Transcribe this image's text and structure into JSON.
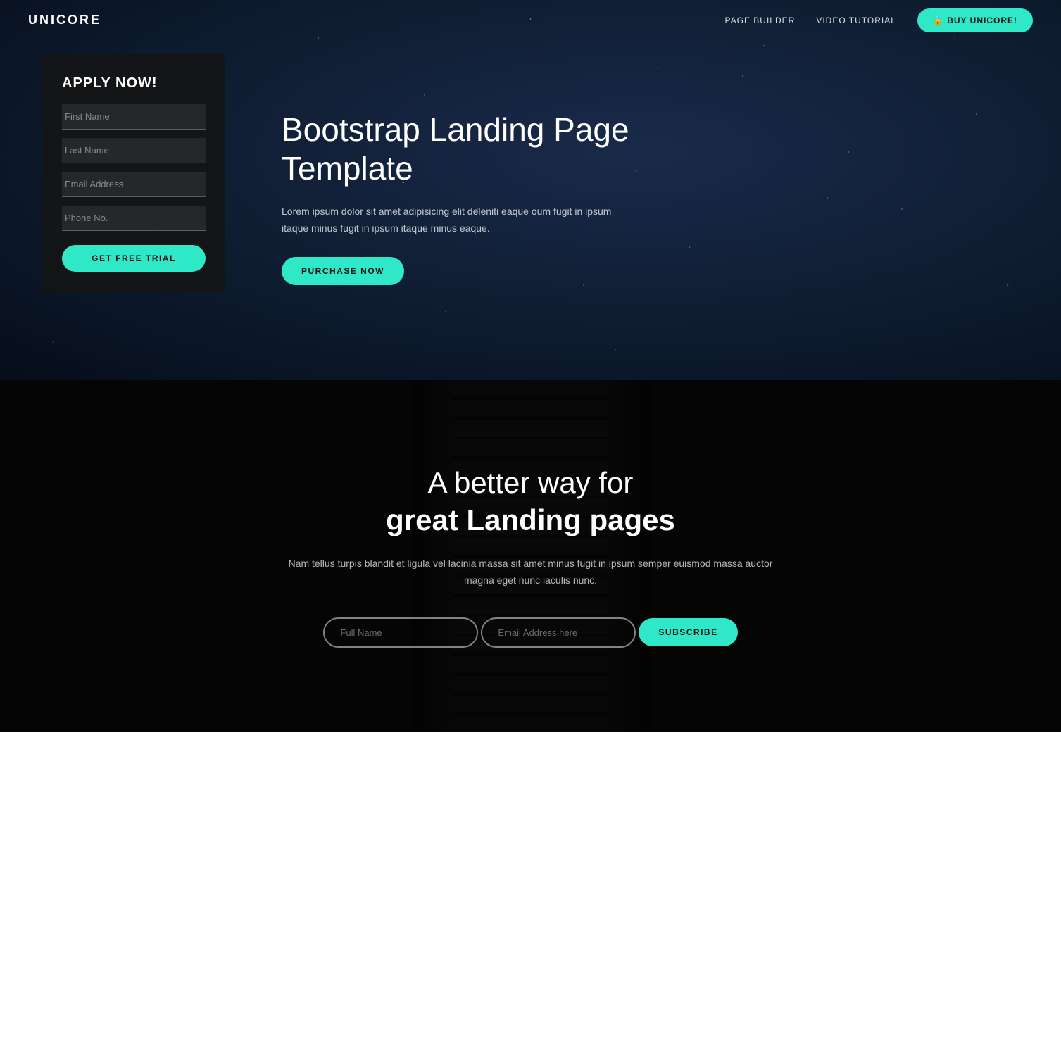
{
  "nav": {
    "logo": "UNICORE",
    "links": [
      {
        "label": "PAGE BUILDER",
        "id": "page-builder"
      },
      {
        "label": "VIDEO TUTORIAL",
        "id": "video-tutorial"
      }
    ],
    "cta": {
      "label": "BUY UNICORE!",
      "icon": "🔒"
    }
  },
  "hero": {
    "form": {
      "title": "APPLY NOW!",
      "fields": [
        {
          "placeholder": "First Name",
          "id": "first-name",
          "type": "text"
        },
        {
          "placeholder": "Last Name",
          "id": "last-name",
          "type": "text"
        },
        {
          "placeholder": "Email Address",
          "id": "email",
          "type": "email"
        },
        {
          "placeholder": "Phone No.",
          "id": "phone",
          "type": "tel"
        }
      ],
      "submit": "GET FREE TRIAL"
    },
    "heading": "Bootstrap Landing Page Template",
    "description": "Lorem ipsum dolor sit amet adipisicing elit deleniti eaque oum fugit in ipsum itaque minus fugit in ipsum itaque minus eaque.",
    "cta": "PURCHASE NOW"
  },
  "section2": {
    "heading_line1": "A better way for",
    "heading_line2": "great Landing pages",
    "description": "Nam tellus turpis blandit et ligula vel lacinia massa sit amet minus fugit in ipsum semper euismod massa auctor magna eget nunc iaculis nunc.",
    "form": {
      "full_name_placeholder": "Full Name",
      "email_placeholder": "Email Address here",
      "submit": "SUBSCRIBE"
    }
  }
}
